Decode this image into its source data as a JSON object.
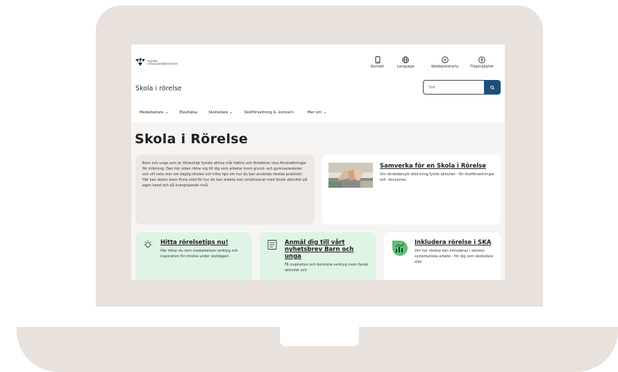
{
  "header": {
    "logo_line1": "VÄSTRA",
    "logo_line2": "GÖTALANDSREGIONEN",
    "utility": [
      {
        "label": "Kontakt",
        "icon": "phone-icon"
      },
      {
        "label": "Language",
        "icon": "globe-icon"
      },
      {
        "label": "Webbplatskarta",
        "icon": "compass-icon"
      },
      {
        "label": "Tillgänglighet",
        "icon": "accessibility-icon"
      }
    ],
    "site_name": "Skola i rörelse",
    "search_placeholder": "Sök"
  },
  "nav": [
    {
      "label": "Medarbetare",
      "dropdown": true
    },
    {
      "label": "Elevhälsa",
      "dropdown": false
    },
    {
      "label": "Skolledare",
      "dropdown": true
    },
    {
      "label": "Skolförvaltning & -koncern",
      "dropdown": false
    },
    {
      "label": "Mer om",
      "dropdown": true
    }
  ],
  "main": {
    "title": "Skola i Rörelse",
    "intro": "Barn och unga som är tillräckligt fysiskt aktiva mår bättre och förbättrar sina förutsättningar för inlärning. Den här sidan riktar sig till dig som arbetar inom grund- och gymnasieskolan och vill veta mer om daglig rörelse och hitta tips om hur du kan använda rörelse praktiskt. Här kan skolor även finna stöd för hur de kan arbeta mer strukturerat med fysisk aktivitet på egen hand och på övergripande nivå.",
    "feature_card": {
      "title": "Samverka för en Skola i Rörelse",
      "description": "Om skräddarsytt stöd kring fysisk aktivitet - för skolförvaltningar och -koncerner."
    },
    "cards": [
      {
        "title": "Hitta rörelsetips nu!",
        "description": "Här hittar du som medarbetare verktyg och inspiration för rörelse under skoldagen.",
        "icon": "lightbulb-icon"
      },
      {
        "title": "Anmäl dig till vårt nyhetsbrev Barn och unga",
        "description": "Få inspiration och konkreta verktyg inom fysisk aktivitet och",
        "icon": "newsletter-icon"
      },
      {
        "title": "Inkludera rörelse i SKA",
        "description": "Om hur rörelse kan inkluderas i skolans systematiska arbete - för dig som skolledare eller",
        "icon": "chart-icon"
      }
    ]
  },
  "colors": {
    "frame": "#e8e1dc",
    "search_button": "#1d4f7a",
    "green_card": "#dff4e5",
    "intro_card": "#ede8e6",
    "icon_green": "#5cc07a"
  }
}
